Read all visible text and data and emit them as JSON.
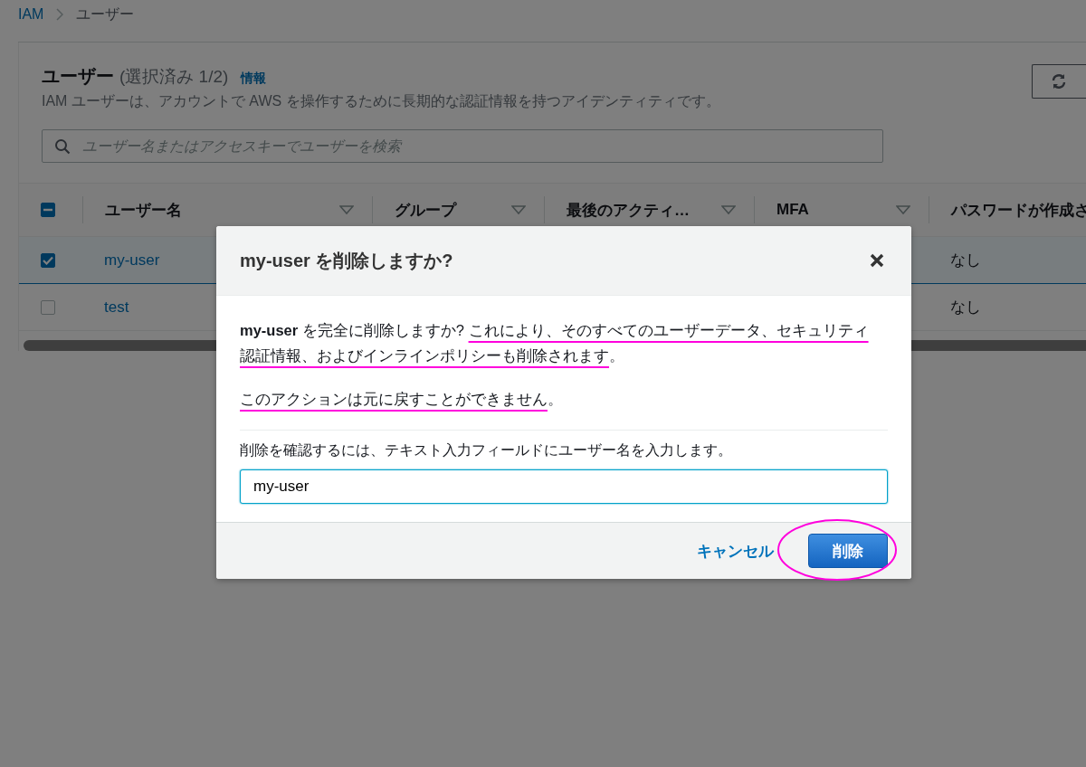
{
  "breadcrumb": [
    {
      "label": "IAM",
      "kind": "link"
    },
    {
      "label": "ユーザー",
      "kind": "current"
    }
  ],
  "panel": {
    "title": "ユーザー",
    "count": "(選択済み 1/2)",
    "info_link": "情報",
    "description": "IAM ユーザーは、アカウントで AWS を操作するために長期的な認証情報を持つアイデンティティです。",
    "search": {
      "placeholder": "ユーザー名またはアクセスキーでユーザーを検索"
    }
  },
  "table": {
    "select_all": {
      "indeterminate": true
    },
    "columns": [
      {
        "label": "ユーザー名",
        "sortable": true
      },
      {
        "label": "グループ",
        "sortable": true
      },
      {
        "label": "最後のアクティ…",
        "sortable": true
      },
      {
        "label": "MFA",
        "sortable": true
      },
      {
        "label": "パスワードが作成さ",
        "sortable": false
      }
    ],
    "rows": [
      {
        "selected": true,
        "user_name": "my-user",
        "password_created": "なし"
      },
      {
        "selected": false,
        "user_name": "test",
        "password_created": "なし"
      }
    ]
  },
  "dialog": {
    "title": "my-user を削除しますか?",
    "paragraphs": [
      [
        {
          "text": "my-user",
          "kind": "bold"
        },
        {
          "text": " を完全に削除しますか? ",
          "kind": "plain"
        },
        {
          "text": "これにより、そのすべてのユーザーデータ、セキュリティ認証情報、およびインラインポリシーも削除されます",
          "kind": "marked"
        },
        {
          "text": "。",
          "kind": "plain"
        }
      ],
      [
        {
          "text": "このアクションは元に戻すことができません",
          "kind": "marked"
        },
        {
          "text": "。",
          "kind": "plain"
        }
      ]
    ],
    "confirm_label": "削除を確認するには、テキスト入力フィールドにユーザー名を入力します。",
    "input_value": "my-user",
    "cancel": "キャンセル",
    "delete": {
      "label": "削除",
      "circled": true
    }
  }
}
